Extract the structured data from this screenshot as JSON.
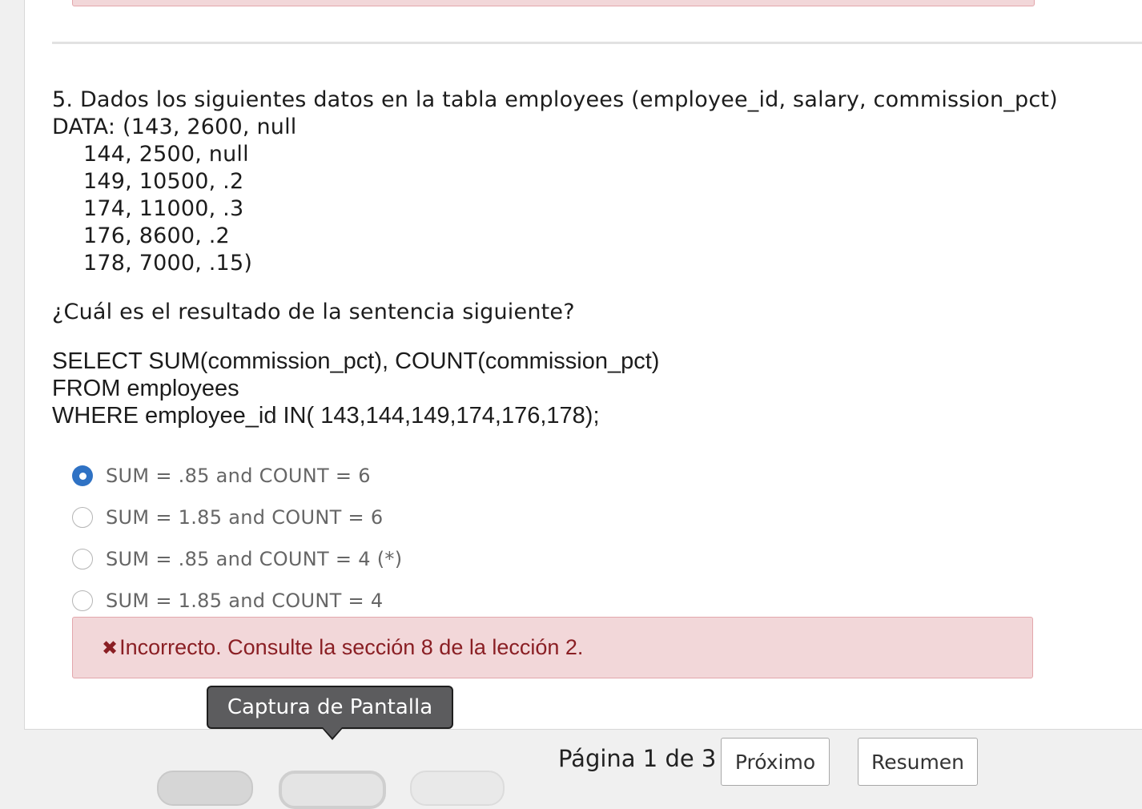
{
  "question": {
    "title": "5. Dados los siguientes datos en la tabla employees (employee_id, salary, commission_pct)",
    "data_first": "DATA: (143, 2600, null",
    "data_rows": [
      "144, 2500, null",
      "149, 10500, .2",
      "174, 11000, .3",
      "176, 8600, .2",
      "178, 7000, .15)"
    ],
    "prompt": "¿Cuál es el resultado de la sentencia siguiente?",
    "sql": [
      "SELECT SUM(commission_pct), COUNT(commission_pct)",
      "FROM employees",
      "WHERE employee_id IN( 143,144,149,174,176,178);"
    ]
  },
  "options": [
    {
      "label": "SUM = .85 and COUNT = 6",
      "selected": true
    },
    {
      "label": "SUM = 1.85 and COUNT = 6",
      "selected": false
    },
    {
      "label": "SUM = .85 and COUNT = 4 (*)",
      "selected": false
    },
    {
      "label": "SUM = 1.85 and COUNT = 4",
      "selected": false
    }
  ],
  "feedback": {
    "icon": "x-icon",
    "text": "Incorrecto. Consulte la sección 8 de la lección 2.",
    "color": "#8a1f24"
  },
  "tooltip": {
    "text": "Captura de Pantalla"
  },
  "footer": {
    "page_indicator": "Página 1 de 3",
    "next_label": "Próximo",
    "summary_label": "Resumen"
  },
  "colors": {
    "accent": "#2f72c4",
    "alert_bg": "#f2d7d9",
    "alert_border": "#e3a7ac"
  }
}
